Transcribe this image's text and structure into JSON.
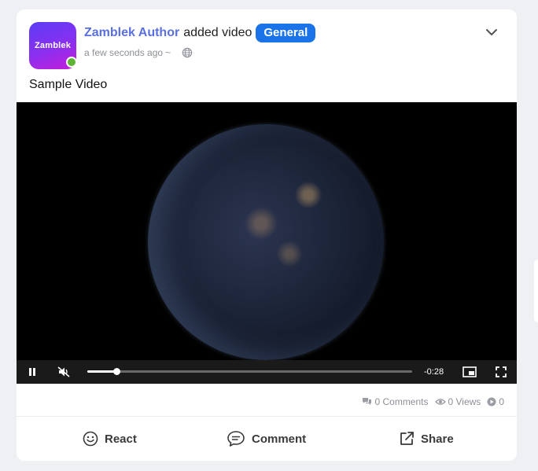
{
  "post": {
    "avatar_text": "Zamblek",
    "author": "Zamblek Author",
    "action": "added video",
    "badge": "General",
    "timestamp": "a few seconds ago",
    "separator": "~",
    "text": "Sample Video"
  },
  "video": {
    "time_remaining": "-0:28",
    "progress": 0.09,
    "muted": true,
    "playing": true
  },
  "stats": {
    "comments": "0 Comments",
    "views": "0 Views",
    "plays": "0"
  },
  "actions": {
    "react_label": "React",
    "comment_label": "Comment",
    "share_label": "Share"
  },
  "colors": {
    "author": "#5a6fe0",
    "badge": "#1a73e8",
    "online": "#5fb336"
  }
}
